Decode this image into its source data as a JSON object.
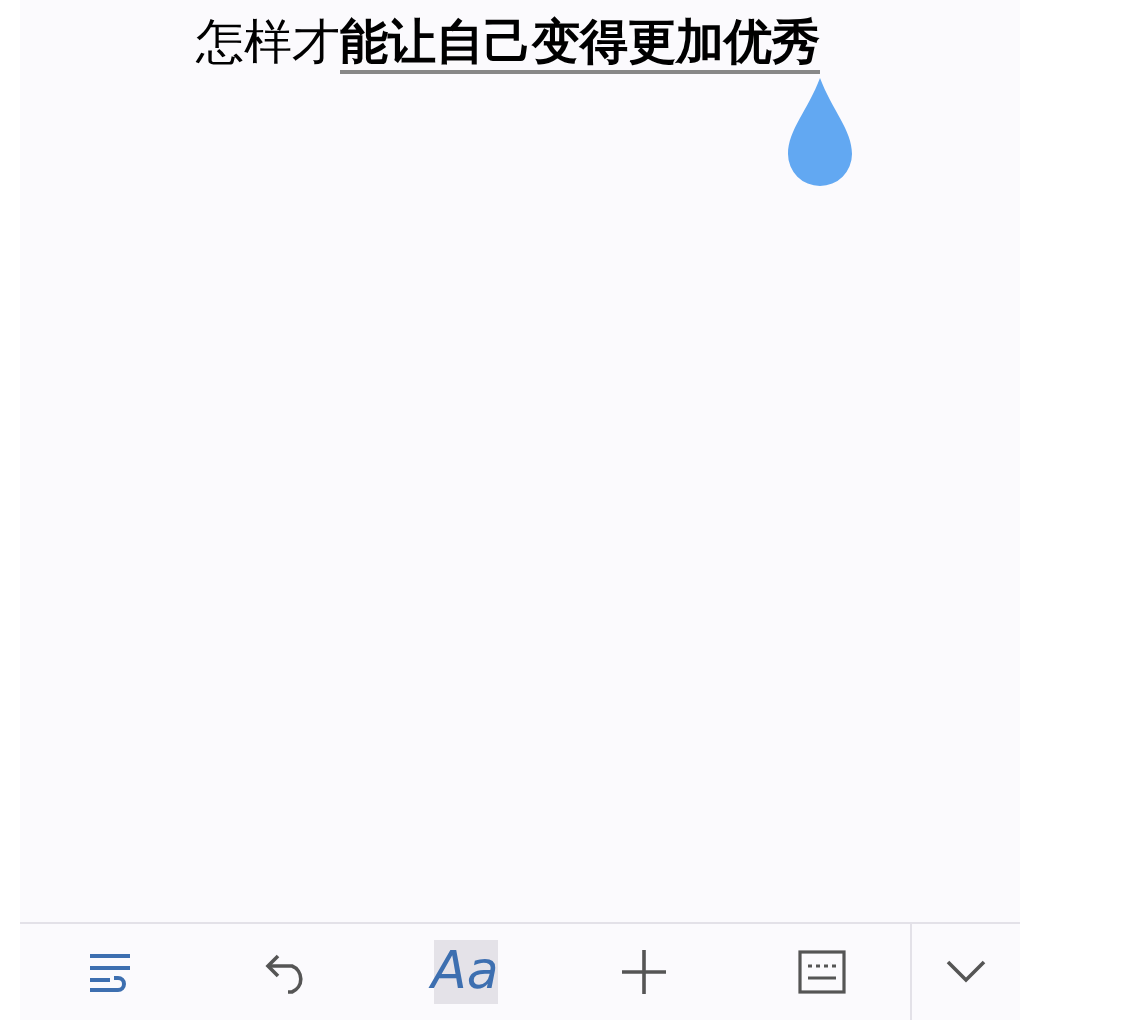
{
  "document": {
    "segments": [
      {
        "text": "怎样才",
        "bold": false,
        "selected": false
      },
      {
        "text": "能让自己变得更加优秀",
        "bold": true,
        "selected": true
      }
    ]
  },
  "toolbar": {
    "items": [
      {
        "kind": "wrap",
        "selected": false
      },
      {
        "kind": "undo",
        "selected": false
      },
      {
        "kind": "font",
        "label": "Aa",
        "selected": true
      },
      {
        "kind": "insert",
        "selected": false
      },
      {
        "kind": "keyboard",
        "selected": false
      }
    ],
    "collapse": {
      "kind": "chevron"
    }
  }
}
